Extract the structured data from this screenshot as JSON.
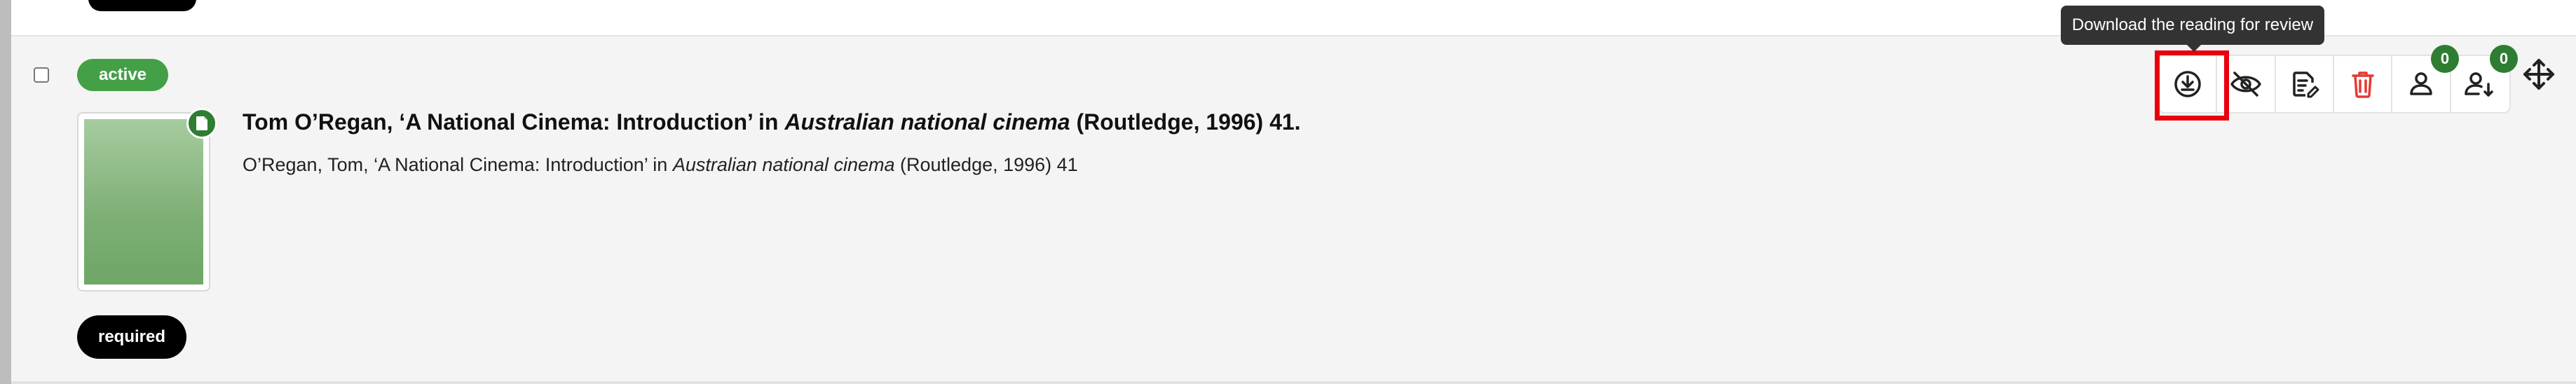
{
  "status_badge": "active",
  "requirement_badge": "required",
  "reading": {
    "title_prefix": "Tom O’Regan, ‘A National Cinema: Introduction’ in ",
    "title_italic": "Australian national cinema",
    "title_suffix": " (Routledge, 1996) 41.",
    "citation_prefix": "O’Regan, Tom, ‘A National Cinema: Introduction’ in ",
    "citation_italic": "Australian national cinema",
    "citation_suffix": " (Routledge, 1996) 41"
  },
  "thumbnail": {
    "badge_icon": "document-icon",
    "gradient_top": "#a6cc9f",
    "gradient_bottom": "#6ea766"
  },
  "toolbar": {
    "tooltip": "Download the reading for review",
    "buttons": [
      {
        "name": "download-review-button",
        "icon": "download-circle-icon"
      },
      {
        "name": "hide-button",
        "icon": "eye-off-icon"
      },
      {
        "name": "edit-notes-button",
        "icon": "document-edit-icon"
      },
      {
        "name": "delete-button",
        "icon": "trash-icon"
      },
      {
        "name": "assign-user-button",
        "icon": "person-icon"
      },
      {
        "name": "user-list-button",
        "icon": "person-sort-icon"
      }
    ],
    "user_count": "0",
    "user_list_count": "0"
  },
  "colors": {
    "accent_green": "#43a047",
    "badge_green": "#2e7d32",
    "delete_red": "#e53935",
    "highlight_red": "#e8000e"
  }
}
